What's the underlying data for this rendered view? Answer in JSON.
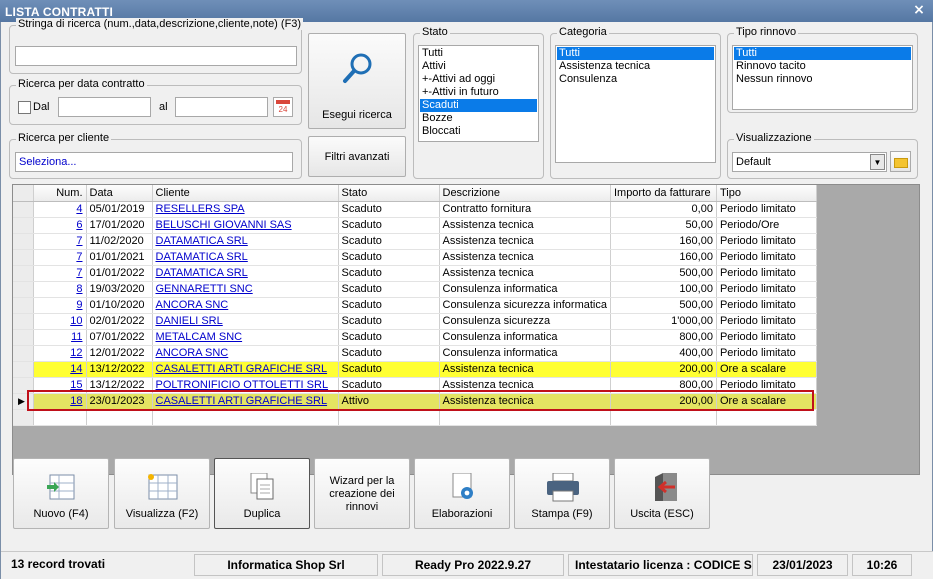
{
  "window": {
    "title": "LISTA CONTRATTI",
    "close_glyph": "×"
  },
  "search": {
    "label": "Stringa di ricerca (num.,data,descrizione,cliente,note) (F3)",
    "value": ""
  },
  "date_search": {
    "label": "Ricerca per data contratto",
    "from_label": "Dal",
    "to_label": "al",
    "from_value": "",
    "to_value": "",
    "calendar_number": "24"
  },
  "client_search": {
    "label": "Ricerca per cliente",
    "value": "Seleziona..."
  },
  "buttons": {
    "search": "Esegui ricerca",
    "advanced": "Filtri avanzati"
  },
  "stato": {
    "label": "Stato",
    "items": [
      "Tutti",
      "Attivi",
      "+-Attivi ad oggi",
      "+-Attivi in futuro",
      "Scaduti",
      "Bozze",
      "Bloccati"
    ],
    "selected": "Scaduti"
  },
  "categoria": {
    "label": "Categoria",
    "items": [
      "Tutti",
      "Assistenza tecnica",
      "Consulenza"
    ],
    "selected": "Tutti"
  },
  "rinnovo": {
    "label": "Tipo rinnovo",
    "items": [
      "Tutti",
      "Rinnovo tacito",
      "Nessun rinnovo"
    ],
    "selected": "Tutti"
  },
  "visualizzazione": {
    "label": "Visualizzazione",
    "value": "Default"
  },
  "table": {
    "columns": [
      "Num.",
      "Data",
      "Cliente",
      "Stato",
      "Descrizione",
      "Importo da fatturare",
      "Tipo"
    ],
    "rows": [
      {
        "num": "4",
        "data": "05/01/2019",
        "cliente": "RESELLERS SPA",
        "stato": "Scaduto",
        "descrizione": "Contratto fornitura",
        "importo": "0,00",
        "tipo": "Periodo limitato",
        "style": ""
      },
      {
        "num": "6",
        "data": "17/01/2020",
        "cliente": "BELUSCHI GIOVANNI SAS",
        "stato": "Scaduto",
        "descrizione": "Assistenza tecnica",
        "importo": "50,00",
        "tipo": "Periodo/Ore",
        "style": ""
      },
      {
        "num": "7",
        "data": "11/02/2020",
        "cliente": "DATAMATICA SRL",
        "stato": "Scaduto",
        "descrizione": "Assistenza tecnica",
        "importo": "160,00",
        "tipo": "Periodo limitato",
        "style": ""
      },
      {
        "num": "7",
        "data": "01/01/2021",
        "cliente": "DATAMATICA SRL",
        "stato": "Scaduto",
        "descrizione": "Assistenza tecnica",
        "importo": "160,00",
        "tipo": "Periodo limitato",
        "style": ""
      },
      {
        "num": "7",
        "data": "01/01/2022",
        "cliente": "DATAMATICA SRL",
        "stato": "Scaduto",
        "descrizione": "Assistenza tecnica",
        "importo": "500,00",
        "tipo": "Periodo limitato",
        "style": ""
      },
      {
        "num": "8",
        "data": "19/03/2020",
        "cliente": "GENNARETTI SNC",
        "stato": "Scaduto",
        "descrizione": "Consulenza informatica",
        "importo": "100,00",
        "tipo": "Periodo limitato",
        "style": ""
      },
      {
        "num": "9",
        "data": "01/10/2020",
        "cliente": "ANCORA SNC",
        "stato": "Scaduto",
        "descrizione": "Consulenza sicurezza informatica",
        "importo": "500,00",
        "tipo": "Periodo limitato",
        "style": ""
      },
      {
        "num": "10",
        "data": "02/01/2022",
        "cliente": "DANIELI SRL",
        "stato": "Scaduto",
        "descrizione": "Consulenza sicurezza",
        "importo": "1'000,00",
        "tipo": "Periodo limitato",
        "style": ""
      },
      {
        "num": "11",
        "data": "07/01/2022",
        "cliente": "METALCAM SNC",
        "stato": "Scaduto",
        "descrizione": "Consulenza informatica",
        "importo": "800,00",
        "tipo": "Periodo limitato",
        "style": ""
      },
      {
        "num": "12",
        "data": "12/01/2022",
        "cliente": "ANCORA SNC",
        "stato": "Scaduto",
        "descrizione": "Consulenza informatica",
        "importo": "400,00",
        "tipo": "Periodo limitato",
        "style": ""
      },
      {
        "num": "14",
        "data": "13/12/2022",
        "cliente": "CASALETTI ARTI GRAFICHE SRL",
        "stato": "Scaduto",
        "descrizione": "Assistenza tecnica",
        "importo": "200,00",
        "tipo": "Ore a scalare",
        "style": "hl"
      },
      {
        "num": "15",
        "data": "13/12/2022",
        "cliente": "POLTRONIFICIO OTTOLETTI SRL",
        "stato": "Scaduto",
        "descrizione": "Assistenza tecnica",
        "importo": "800,00",
        "tipo": "Periodo limitato",
        "style": ""
      },
      {
        "num": "18",
        "data": "23/01/2023",
        "cliente": "CASALETTI ARTI GRAFICHE SRL",
        "stato": "Attivo",
        "descrizione": "Assistenza tecnica",
        "importo": "200,00",
        "tipo": "Ore a scalare",
        "style": "act"
      }
    ]
  },
  "actions": [
    {
      "label": "Nuovo (F4)",
      "icon": "new-document-icon"
    },
    {
      "label": "Visualizza (F2)",
      "icon": "grid-view-icon"
    },
    {
      "label": "Duplica",
      "icon": "duplicate-icon"
    },
    {
      "label": "Wizard per la creazione dei rinnovi",
      "icon": ""
    },
    {
      "label": "Elaborazioni",
      "icon": "gear-document-icon"
    },
    {
      "label": "Stampa (F9)",
      "icon": "printer-icon"
    },
    {
      "label": "Uscita (ESC)",
      "icon": "exit-door-icon"
    }
  ],
  "status": {
    "records": "13 record trovati",
    "company": "Informatica Shop Srl",
    "version": "Ready Pro 2022.9.27",
    "license": "Intestatario licenza : CODICE SR",
    "date": "23/01/2023",
    "time": "10:26"
  },
  "colors": {
    "accent": "#0a7be8",
    "highlight": "#ffff33",
    "active_row": "#e4e462",
    "frame": "#c0101a"
  }
}
